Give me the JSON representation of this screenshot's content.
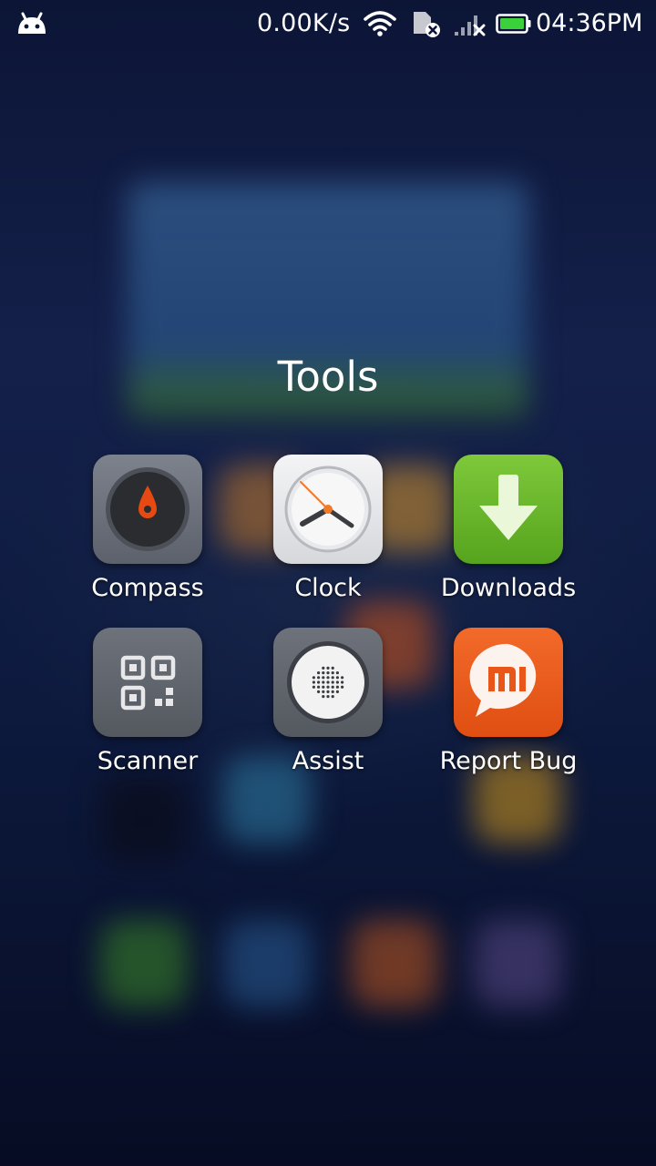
{
  "status_bar": {
    "net_speed": "0.00K/s",
    "time": "04:36PM",
    "icons": [
      "android-icon",
      "wifi-icon",
      "sim-missing-icon",
      "signal-no-service-icon",
      "battery-full-icon"
    ],
    "battery_color": "#3ad13a"
  },
  "folder": {
    "title": "Tools",
    "apps": [
      {
        "label": "Compass",
        "icon": "compass-icon"
      },
      {
        "label": "Clock",
        "icon": "clock-icon"
      },
      {
        "label": "Downloads",
        "icon": "download-arrow-icon"
      },
      {
        "label": "Scanner",
        "icon": "qr-code-icon"
      },
      {
        "label": "Assist",
        "icon": "assist-icon"
      },
      {
        "label": "Report Bug",
        "icon": "mi-feedback-icon"
      }
    ]
  }
}
